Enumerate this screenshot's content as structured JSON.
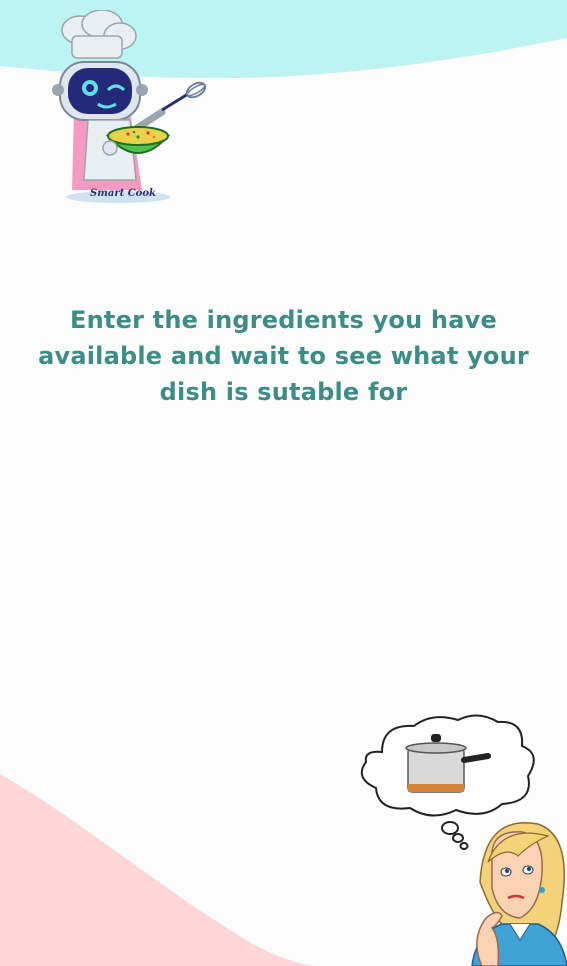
{
  "logo": {
    "caption": "Smart Cook"
  },
  "message": {
    "text": "Enter the ingredients you have available and wait to see what your dish is sutable for"
  },
  "colors": {
    "top_wave": "#bdf3f2",
    "bottom_wave": "#fdd6d7",
    "text": "#3d8c86"
  },
  "illustrations": {
    "mascot": "chef-robot-icon",
    "thinking": "woman-thinking-cooking-pot-icon"
  }
}
